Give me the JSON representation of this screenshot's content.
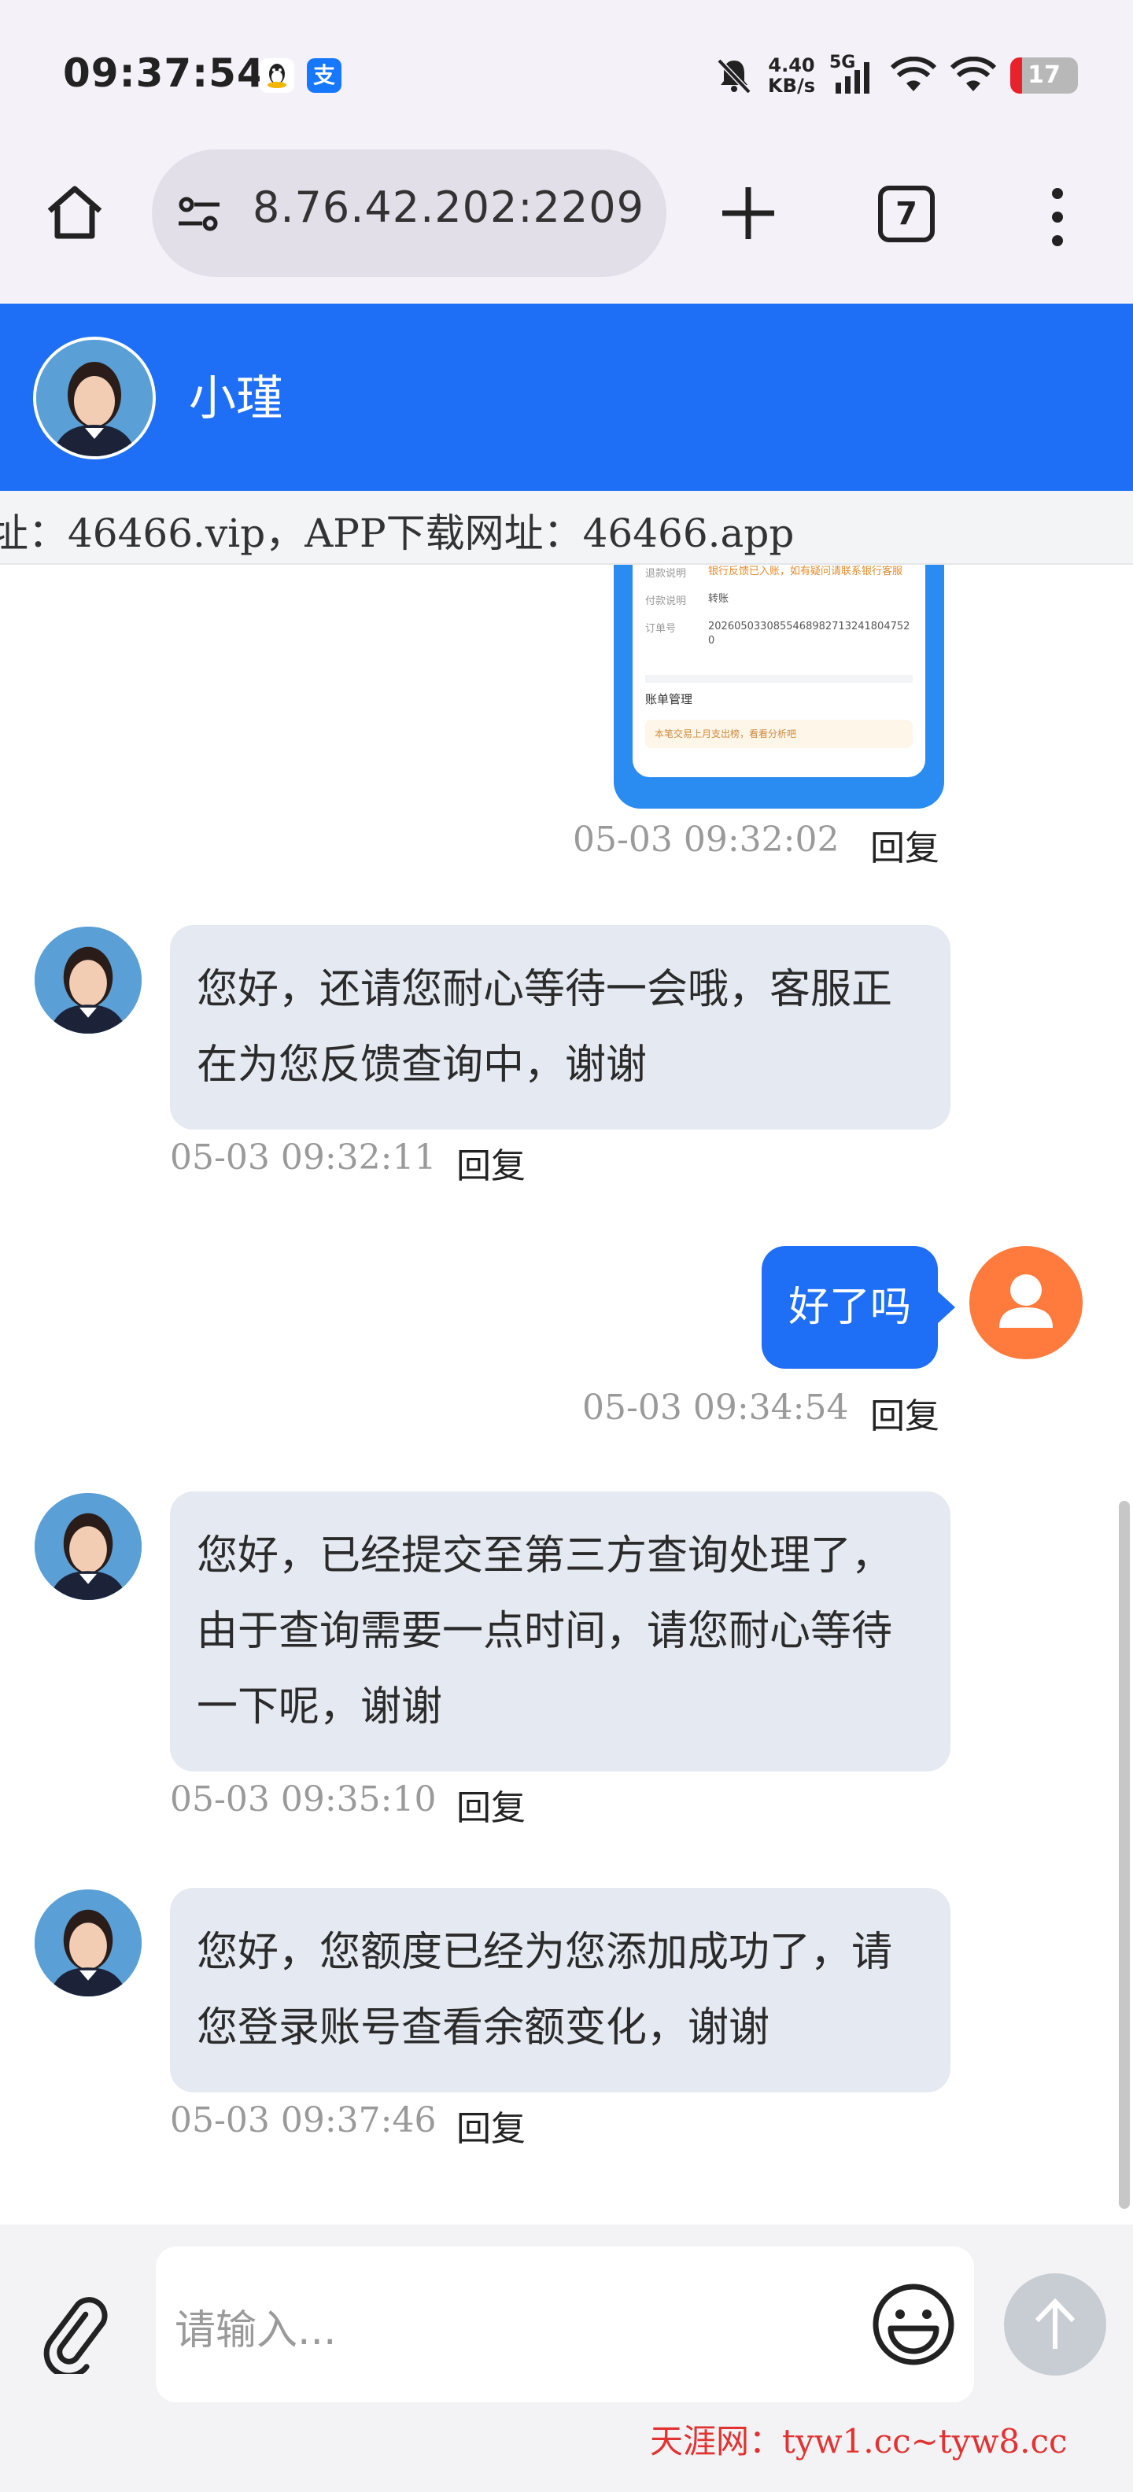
{
  "status_bar": {
    "time": "09:37:54",
    "alipay_glyph": "支",
    "net_speed_value": "4.40",
    "net_speed_unit": "KB/s",
    "network": "5G",
    "battery": "17",
    "battery_level_percent": 17,
    "icons": [
      "qq-icon",
      "alipay-icon",
      "mute-bell-icon",
      "signal-icon",
      "wifi-icon",
      "wifi-icon",
      "battery-icon"
    ]
  },
  "browser": {
    "url": "8.76.42.202:2209",
    "tab_count": "7"
  },
  "chat": {
    "agent_name": "小瑾",
    "notice": "址：46466.vip，APP下载网址：46466.app",
    "screenshot_preview": {
      "rows": [
        {
          "key": "退款说明",
          "value": "银行反馈已入账，如有疑问请联系银行客服"
        },
        {
          "key": "付款说明",
          "value": "转账"
        },
        {
          "key": "订单号",
          "value": "20260503308554689827132418047520"
        }
      ],
      "section_title": "账单管理",
      "tip": "本笔交易上月支出榜，看看分析吧"
    },
    "messages": [
      {
        "from": "user",
        "kind": "image",
        "time": "05-03 09:32:02",
        "reply": "回复"
      },
      {
        "from": "agent",
        "text": "您好，还请您耐心等待一会哦，客服正在为您反馈查询中，谢谢",
        "time": "05-03 09:32:11",
        "reply": "回复"
      },
      {
        "from": "user",
        "text": "好了吗",
        "time": "05-03 09:34:54",
        "reply": "回复"
      },
      {
        "from": "agent",
        "text": "您好，已经提交至第三方查询处理了，由于查询需要一点时间，请您耐心等待一下呢，谢谢",
        "time": "05-03 09:35:10",
        "reply": "回复"
      },
      {
        "from": "agent",
        "text": "您好，您额度已经为您添加成功了，请您登录账号查看余额变化，谢谢",
        "time": "05-03 09:37:46",
        "reply": "回复"
      }
    ]
  },
  "composer": {
    "placeholder": "请输入..."
  },
  "watermark": "天涯网：tyw1.cc~tyw8.cc"
}
